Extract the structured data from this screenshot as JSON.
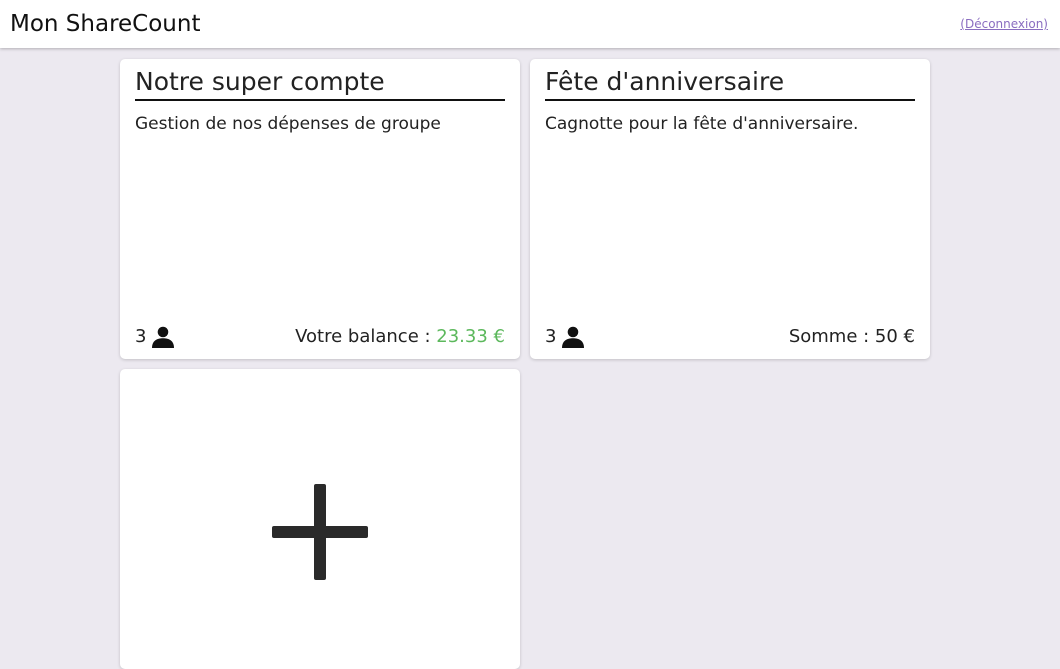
{
  "header": {
    "title": "Mon ShareCount",
    "logout_label": "(Déconnexion)"
  },
  "cards": [
    {
      "title": "Notre super compte",
      "description": "Gestion de nos dépenses de groupe",
      "members_count": "3",
      "members_icon": "user-icon",
      "footer_label": "Votre balance : ",
      "footer_value": "23.33 €",
      "footer_value_color": "#5cb85c"
    },
    {
      "title": "Fête d'anniversaire",
      "description": "Cagnotte pour la fête d'anniversaire.",
      "members_count": "3",
      "members_icon": "user-icon",
      "footer_label": "Somme : ",
      "footer_value": "50 €"
    }
  ],
  "add_card": {
    "icon": "plus-icon"
  },
  "colors": {
    "accent_link": "#8a6dc0",
    "positive": "#5cb85c",
    "background": "#ece9f0"
  }
}
